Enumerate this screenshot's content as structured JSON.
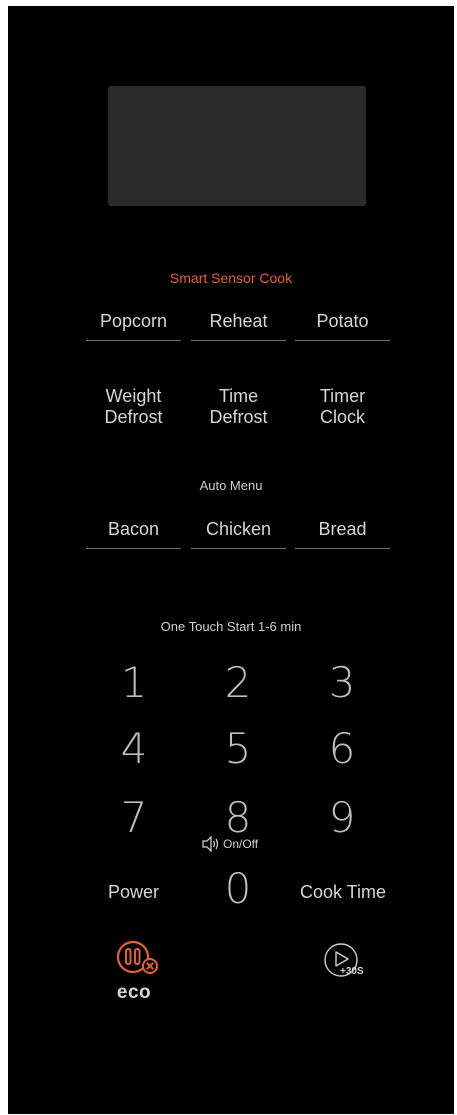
{
  "labels": {
    "smart_sensor": "Smart Sensor Cook",
    "auto_menu": "Auto Menu",
    "one_touch": "One Touch Start 1-6 min",
    "sound_toggle": "On/Off"
  },
  "sensor_buttons": [
    "Popcorn",
    "Reheat",
    "Potato"
  ],
  "defrost_buttons": [
    {
      "line1": "Weight",
      "line2": "Defrost"
    },
    {
      "line1": "Time",
      "line2": "Defrost"
    },
    {
      "line1": "Timer",
      "line2": "Clock"
    }
  ],
  "auto_buttons": [
    "Bacon",
    "Chicken",
    "Bread"
  ],
  "digits": [
    "1",
    "2",
    "3",
    "4",
    "5",
    "6",
    "7",
    "8",
    "9",
    "0"
  ],
  "bottom_buttons": {
    "power": "Power",
    "cook_time": "Cook Time"
  },
  "eco": {
    "label": "eco"
  },
  "start_plus30": {
    "label": "+30S"
  },
  "colors": {
    "panel": "#000000",
    "display": "#2b2b2b",
    "accent": "#e4622e",
    "text": "#d6d6d6",
    "divider": "#6e6e6e"
  },
  "icons": {
    "sound": "speaker-icon",
    "eco": "eco-pause-cancel-icon",
    "start": "play-icon"
  }
}
